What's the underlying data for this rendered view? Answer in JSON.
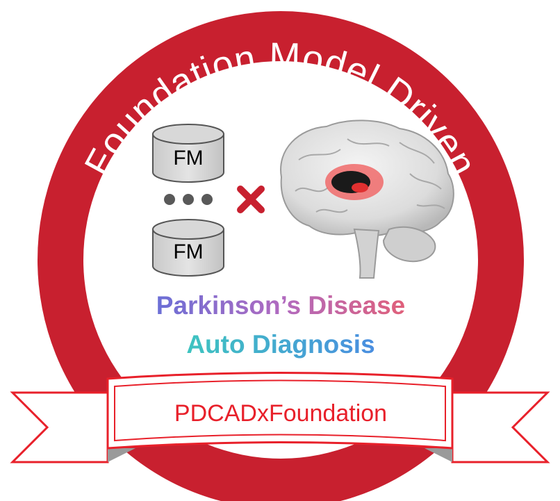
{
  "badge": {
    "arc_title": "Foundation Model Driven",
    "ring_color": "#c8202f",
    "fm_label": "FM",
    "combine_icon": "cross-icon",
    "brain_icon": "brain-icon",
    "tagline_line1": "Parkinson’s Disease",
    "tagline_line2": "Auto Diagnosis",
    "banner_label": "PDCADxFoundation",
    "banner_color": "#e8202a"
  }
}
